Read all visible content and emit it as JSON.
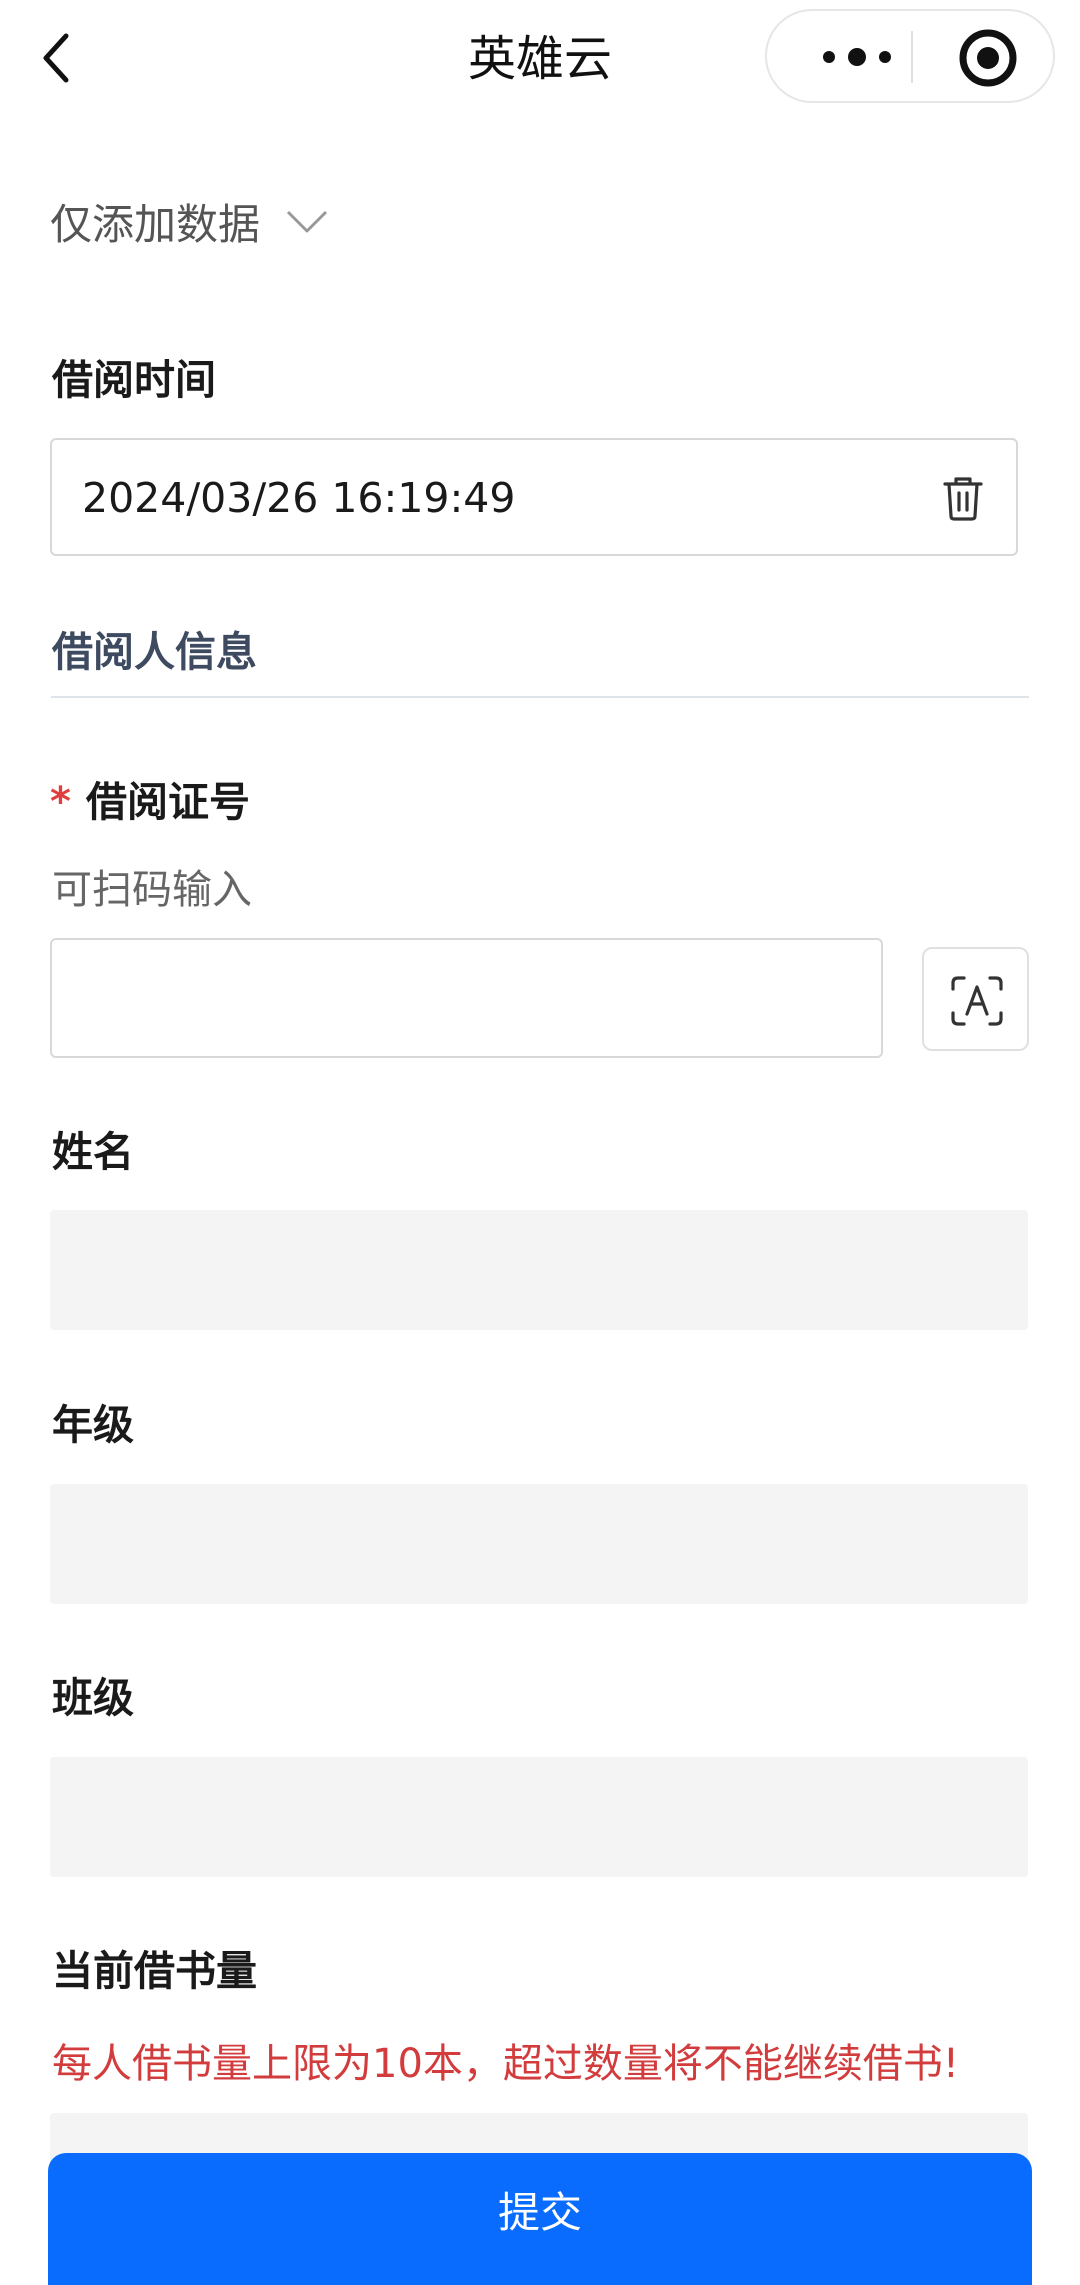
{
  "nav": {
    "title": "英雄云"
  },
  "mode_select": {
    "value": "仅添加数据"
  },
  "fields": {
    "borrow_time": {
      "label": "借阅时间",
      "value": "2024/03/26 16:19:49"
    },
    "section_title": "借阅人信息",
    "card_no": {
      "required_mark": "*",
      "label": "借阅证号",
      "hint": "可扫码输入",
      "value": ""
    },
    "name": {
      "label": "姓名",
      "value": ""
    },
    "grade": {
      "label": "年级",
      "value": ""
    },
    "class": {
      "label": "班级",
      "value": ""
    },
    "borrow_count": {
      "label": "当前借书量",
      "warning": "每人借书量上限为10本，超过数量将不能继续借书!",
      "value": ""
    }
  },
  "submit_label": "提交",
  "colors": {
    "primary": "#0a6cff",
    "required": "#e03e3e",
    "warning": "#d23c3c",
    "section_title": "#3d4a60",
    "disabled_fill": "#f4f4f4"
  },
  "icons": {
    "back": "chevron-left-icon",
    "more": "more-dots-icon",
    "close": "target-circle-icon",
    "dropdown": "chevron-down-icon",
    "clear": "trash-icon",
    "scan": "scan-text-icon"
  }
}
